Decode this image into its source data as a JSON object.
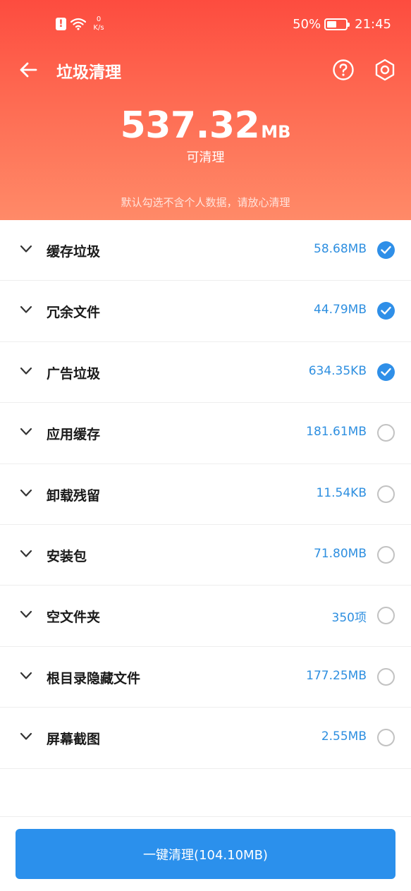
{
  "status_bar": {
    "net_speed_value": "0",
    "net_speed_unit": "K/s",
    "battery": "50%",
    "battery_level": 0.5,
    "time": "21:45"
  },
  "header": {
    "title": "垃圾清理",
    "total_value": "537.32",
    "total_unit": "MB",
    "total_caption": "可清理",
    "note": "默认勾选不含个人数据，请放心清理"
  },
  "items": [
    {
      "label": "缓存垃圾",
      "size": "58.68MB",
      "checked": true
    },
    {
      "label": "冗余文件",
      "size": "44.79MB",
      "checked": true
    },
    {
      "label": "广告垃圾",
      "size": "634.35KB",
      "checked": true
    },
    {
      "label": "应用缓存",
      "size": "181.61MB",
      "checked": false
    },
    {
      "label": "卸载残留",
      "size": "11.54KB",
      "checked": false
    },
    {
      "label": "安装包",
      "size": "71.80MB",
      "checked": false
    },
    {
      "label": "空文件夹",
      "size": "350项",
      "checked": false
    },
    {
      "label": "根目录隐藏文件",
      "size": "177.25MB",
      "checked": false
    },
    {
      "label": "屏幕截图",
      "size": "2.55MB",
      "checked": false
    }
  ],
  "footer": {
    "clean_button": "一键清理(104.10MB)"
  },
  "colors": {
    "header_top": "#fd4c3f",
    "header_bottom": "#ff8a68",
    "accent": "#2b90ec",
    "size_text": "#2e8fe0"
  }
}
